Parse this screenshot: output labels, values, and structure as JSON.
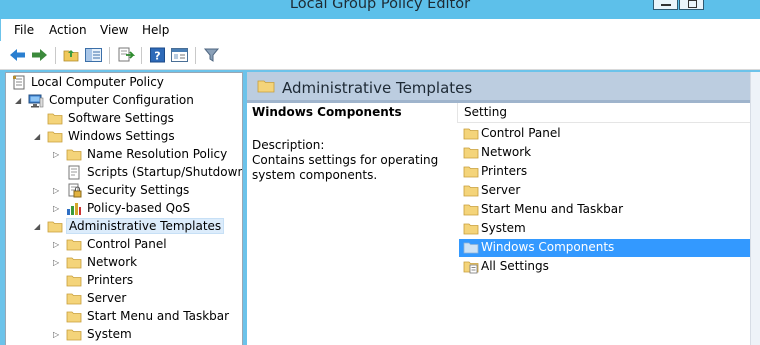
{
  "window": {
    "title": "Local Group Policy Editor"
  },
  "menu": [
    "File",
    "Action",
    "View",
    "Help"
  ],
  "toolbar": [
    "back-icon",
    "forward-icon",
    "up-folder-icon",
    "show-hide-tree-icon",
    "export-list-icon",
    "help-icon",
    "properties-icon",
    "filter-icon"
  ],
  "tree": [
    {
      "label": "Local Computer Policy",
      "icon": "policy-document-icon",
      "expander": ""
    },
    {
      "label": "Computer Configuration",
      "icon": "computer-icon",
      "expander": "expanded"
    },
    {
      "label": "Software Settings",
      "icon": "folder-icon",
      "expander": ""
    },
    {
      "label": "Windows Settings",
      "icon": "folder-icon",
      "expander": "expanded"
    },
    {
      "label": "Name Resolution Policy",
      "icon": "folder-icon",
      "expander": "collapsed"
    },
    {
      "label": "Scripts (Startup/Shutdown)",
      "icon": "script-icon",
      "expander": ""
    },
    {
      "label": "Security Settings",
      "icon": "security-icon",
      "expander": "collapsed"
    },
    {
      "label": "Policy-based QoS",
      "icon": "qos-chart-icon",
      "expander": "collapsed"
    },
    {
      "label": "Administrative Templates",
      "icon": "folder-icon",
      "expander": "expanded",
      "selected": true
    },
    {
      "label": "Control Panel",
      "icon": "folder-icon",
      "expander": "collapsed"
    },
    {
      "label": "Network",
      "icon": "folder-icon",
      "expander": "collapsed"
    },
    {
      "label": "Printers",
      "icon": "folder-icon",
      "expander": ""
    },
    {
      "label": "Server",
      "icon": "folder-icon",
      "expander": ""
    },
    {
      "label": "Start Menu and Taskbar",
      "icon": "folder-icon",
      "expander": ""
    },
    {
      "label": "System",
      "icon": "folder-icon",
      "expander": "collapsed"
    }
  ],
  "detail": {
    "header": "Administrative Templates",
    "selected_name": "Windows Components",
    "description_label": "Description:",
    "description_text": "Contains settings for operating system components.",
    "column_header": "Setting",
    "items": [
      {
        "label": "Control Panel",
        "icon": "folder-icon"
      },
      {
        "label": "Network",
        "icon": "folder-icon"
      },
      {
        "label": "Printers",
        "icon": "folder-icon"
      },
      {
        "label": "Server",
        "icon": "folder-icon"
      },
      {
        "label": "Start Menu and Taskbar",
        "icon": "folder-icon"
      },
      {
        "label": "System",
        "icon": "folder-icon"
      },
      {
        "label": "Windows Components",
        "icon": "folder-icon",
        "selected": true
      },
      {
        "label": "All Settings",
        "icon": "all-settings-icon"
      }
    ]
  },
  "colors": {
    "accent": "#5dc0ea",
    "selection": "#3399ff",
    "header": "#bccde0",
    "folder": "#f4d47a"
  }
}
